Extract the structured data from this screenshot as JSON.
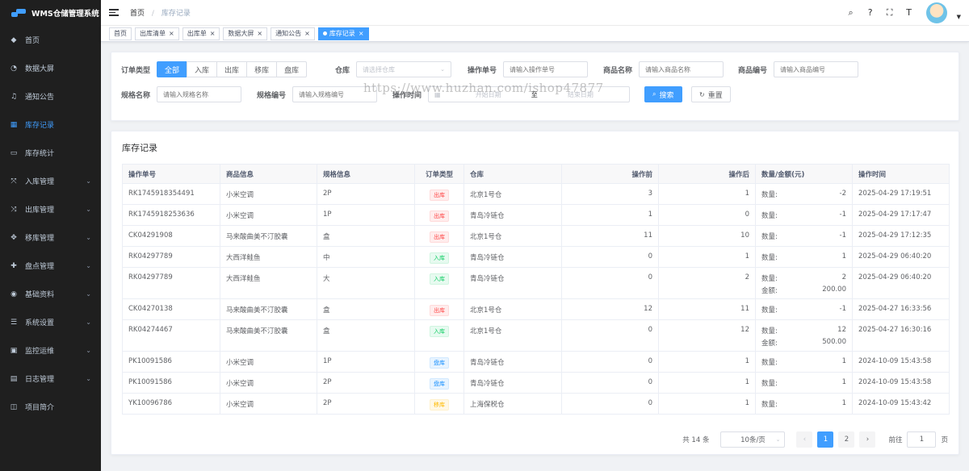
{
  "app": {
    "title": "WMS仓储管理系统"
  },
  "sidebar": {
    "items": [
      {
        "label": "首页",
        "icon": "home-icon",
        "glyph": "◆",
        "arrow": ""
      },
      {
        "label": "数据大屏",
        "icon": "dashboard-icon",
        "glyph": "◔",
        "arrow": ""
      },
      {
        "label": "通知公告",
        "icon": "bell-icon",
        "glyph": "♫",
        "arrow": ""
      },
      {
        "label": "库存记录",
        "icon": "table-icon",
        "glyph": "▦",
        "arrow": ""
      },
      {
        "label": "库存统计",
        "icon": "monitor-icon",
        "glyph": "▭",
        "arrow": ""
      },
      {
        "label": "入库管理",
        "icon": "inbound-icon",
        "glyph": "⤧",
        "arrow": "⌄"
      },
      {
        "label": "出库管理",
        "icon": "outbound-icon",
        "glyph": "⤨",
        "arrow": "⌄"
      },
      {
        "label": "移库管理",
        "icon": "move-icon",
        "glyph": "✥",
        "arrow": "⌄"
      },
      {
        "label": "盘点管理",
        "icon": "check-icon",
        "glyph": "✚",
        "arrow": "⌄"
      },
      {
        "label": "基础资料",
        "icon": "target-icon",
        "glyph": "◉",
        "arrow": "⌄"
      },
      {
        "label": "系统设置",
        "icon": "settings-icon",
        "glyph": "☰",
        "arrow": "⌄"
      },
      {
        "label": "监控运维",
        "icon": "monitor-ops-icon",
        "glyph": "▣",
        "arrow": "⌄"
      },
      {
        "label": "日志管理",
        "icon": "log-icon",
        "glyph": "▤",
        "arrow": "⌄"
      },
      {
        "label": "项目简介",
        "icon": "book-icon",
        "glyph": "◫",
        "arrow": ""
      }
    ],
    "active_index": 3
  },
  "breadcrumb": {
    "home": "首页",
    "separator": "/",
    "current": "库存记录"
  },
  "navbar_icons": [
    {
      "name": "search-icon",
      "glyph": "⌕"
    },
    {
      "name": "help-icon",
      "glyph": "?"
    },
    {
      "name": "fullscreen-icon",
      "glyph": "⛶"
    },
    {
      "name": "font-size-icon",
      "glyph": "T"
    }
  ],
  "tags": [
    {
      "label": "首页",
      "closable": false,
      "active": false
    },
    {
      "label": "出库清单",
      "closable": true,
      "active": false
    },
    {
      "label": "出库单",
      "closable": true,
      "active": false
    },
    {
      "label": "数据大屏",
      "closable": true,
      "active": false
    },
    {
      "label": "通知公告",
      "closable": true,
      "active": false
    },
    {
      "label": "库存记录",
      "closable": true,
      "active": true
    }
  ],
  "search": {
    "order_type_label": "订单类型",
    "order_types": [
      "全部",
      "入库",
      "出库",
      "移库",
      "盘库"
    ],
    "order_type_selected": 0,
    "warehouse_label": "仓库",
    "warehouse_placeholder": "请选择仓库",
    "op_no_label": "操作单号",
    "op_no_placeholder": "请输入操作单号",
    "goods_name_label": "商品名称",
    "goods_name_placeholder": "请输入商品名称",
    "goods_code_label": "商品编号",
    "goods_code_placeholder": "请输入商品编号",
    "spec_name_label": "规格名称",
    "spec_name_placeholder": "请输入规格名称",
    "spec_code_label": "规格编号",
    "spec_code_placeholder": "请输入规格编号",
    "op_time_label": "操作时间",
    "start_placeholder": "开始日期",
    "range_sep": "至",
    "end_placeholder": "结束日期",
    "search_btn": "搜索",
    "reset_btn": "重置"
  },
  "watermark": "https://www.huzhan.com/ishop47877",
  "table": {
    "title": "库存记录",
    "columns": [
      "操作单号",
      "商品信息",
      "规格信息",
      "订单类型",
      "仓库",
      "操作前",
      "操作后",
      "数量/金额(元)",
      "操作时间"
    ],
    "qty_label": "数量:",
    "amt_label": "金额:",
    "type_colors": {
      "出库": {
        "fg": "#ff4949",
        "bg": "#ffeded",
        "border": "#ffdbdb"
      },
      "入库": {
        "fg": "#13ce66",
        "bg": "#e7faf0",
        "border": "#d0f5e0"
      },
      "盘库": {
        "fg": "#1890ff",
        "bg": "#e8f4ff",
        "border": "#d1e9ff"
      },
      "移库": {
        "fg": "#ffba00",
        "bg": "#fff8e6",
        "border": "#fff1cc"
      }
    },
    "rows": [
      {
        "no": "RK1745918354491",
        "goods": "小米空调",
        "spec": "2P",
        "type": "出库",
        "warehouse": "北京1号仓",
        "before": "3",
        "after": "1",
        "qty": "-2",
        "amount": "",
        "time": "2025-04-29 17:19:51"
      },
      {
        "no": "RK1745918253636",
        "goods": "小米空调",
        "spec": "1P",
        "type": "出库",
        "warehouse": "青岛冷链仓",
        "before": "1",
        "after": "0",
        "qty": "-1",
        "amount": "",
        "time": "2025-04-29 17:17:47"
      },
      {
        "no": "CK04291908",
        "goods": "马来酸曲美不汀胶囊",
        "spec": "盒",
        "type": "出库",
        "warehouse": "北京1号仓",
        "before": "11",
        "after": "10",
        "qty": "-1",
        "amount": "",
        "time": "2025-04-29 17:12:35"
      },
      {
        "no": "RK04297789",
        "goods": "大西洋鲑鱼",
        "spec": "中",
        "type": "入库",
        "warehouse": "青岛冷链仓",
        "before": "0",
        "after": "1",
        "qty": "1",
        "amount": "",
        "time": "2025-04-29 06:40:20"
      },
      {
        "no": "RK04297789",
        "goods": "大西洋鲑鱼",
        "spec": "大",
        "type": "入库",
        "warehouse": "青岛冷链仓",
        "before": "0",
        "after": "2",
        "qty": "2",
        "amount": "200.00",
        "time": "2025-04-29 06:40:20"
      },
      {
        "no": "CK04270138",
        "goods": "马来酸曲美不汀胶囊",
        "spec": "盒",
        "type": "出库",
        "warehouse": "北京1号仓",
        "before": "12",
        "after": "11",
        "qty": "-1",
        "amount": "",
        "time": "2025-04-27 16:33:56"
      },
      {
        "no": "RK04274467",
        "goods": "马来酸曲美不汀胶囊",
        "spec": "盒",
        "type": "入库",
        "warehouse": "北京1号仓",
        "before": "0",
        "after": "12",
        "qty": "12",
        "amount": "500.00",
        "time": "2025-04-27 16:30:16"
      },
      {
        "no": "PK10091586",
        "goods": "小米空调",
        "spec": "1P",
        "type": "盘库",
        "warehouse": "青岛冷链仓",
        "before": "0",
        "after": "1",
        "qty": "1",
        "amount": "",
        "time": "2024-10-09 15:43:58"
      },
      {
        "no": "PK10091586",
        "goods": "小米空调",
        "spec": "2P",
        "type": "盘库",
        "warehouse": "青岛冷链仓",
        "before": "0",
        "after": "1",
        "qty": "1",
        "amount": "",
        "time": "2024-10-09 15:43:58"
      },
      {
        "no": "YK10096786",
        "goods": "小米空调",
        "spec": "2P",
        "type": "移库",
        "warehouse": "上海保税仓",
        "before": "0",
        "after": "1",
        "qty": "1",
        "amount": "",
        "time": "2024-10-09 15:43:42"
      }
    ]
  },
  "pagination": {
    "total": "共 14 条",
    "page_size": "10条/页",
    "prev": "‹",
    "next": "›",
    "pages": [
      "1",
      "2"
    ],
    "current_page": 0,
    "goto_label": "前往",
    "goto_value": "1",
    "page_suffix": "页"
  },
  "colors": {
    "primary": "#409eff",
    "sidebar_bg": "#1f1f1f"
  }
}
